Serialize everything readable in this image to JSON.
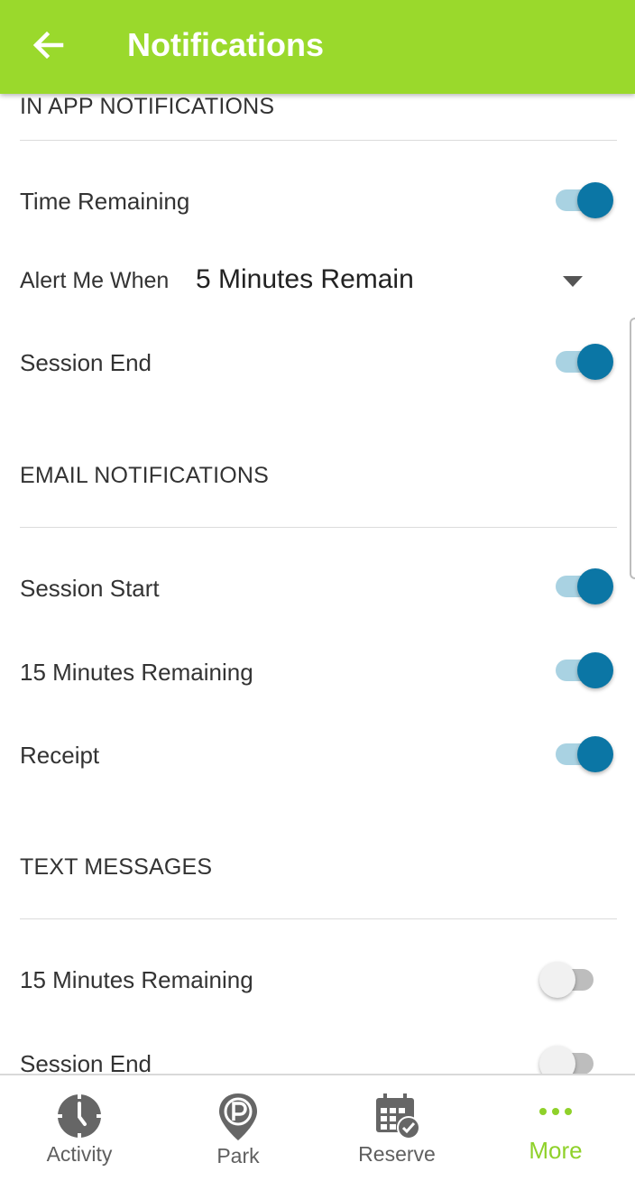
{
  "header": {
    "title": "Notifications",
    "background_color": "#9ad92c",
    "back_icon": "arrow-left-icon"
  },
  "sections": {
    "in_app": {
      "title": "IN APP NOTIFICATIONS",
      "time_remaining": {
        "label": "Time Remaining",
        "enabled": true
      },
      "alert_me_when": {
        "label": "Alert Me When",
        "value": "5 Minutes Remain"
      },
      "session_end": {
        "label": "Session End",
        "enabled": true
      }
    },
    "email": {
      "title": "EMAIL NOTIFICATIONS",
      "session_start": {
        "label": "Session Start",
        "enabled": true
      },
      "fifteen_min": {
        "label": "15 Minutes Remaining",
        "enabled": true
      },
      "receipt": {
        "label": "Receipt",
        "enabled": true
      }
    },
    "text": {
      "title": "TEXT MESSAGES",
      "fifteen_min": {
        "label": "15 Minutes Remaining",
        "enabled": false
      },
      "session_end": {
        "label": "Session End",
        "enabled": false
      }
    }
  },
  "toggle_colors": {
    "on_knob": "#0b76a5",
    "on_track": "#a9d2e2",
    "off_knob": "#f1f1f1",
    "off_track": "#bdbdbd"
  },
  "bottom_nav": {
    "items": [
      {
        "label": "Activity",
        "icon": "clock-icon",
        "active": false
      },
      {
        "label": "Park",
        "icon": "parking-pin-icon",
        "active": false
      },
      {
        "label": "Reserve",
        "icon": "calendar-check-icon",
        "active": false
      },
      {
        "label": "More",
        "icon": "more-dots-icon",
        "active": true
      }
    ],
    "active_color": "#8fd12a",
    "inactive_color": "#5f5f5f"
  }
}
